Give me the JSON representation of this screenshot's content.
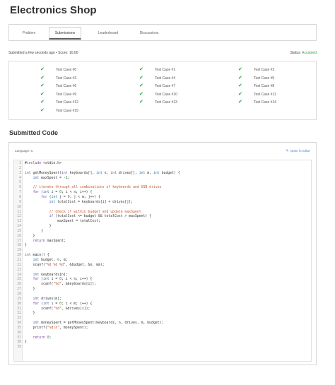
{
  "page": {
    "title": "Electronics Shop"
  },
  "tabs": [
    {
      "label": "Problem",
      "active": false
    },
    {
      "label": "Submissions",
      "active": true
    },
    {
      "label": "Leaderboard",
      "active": false
    },
    {
      "label": "Discussions",
      "active": false
    }
  ],
  "submission": {
    "info": "Submitted a few seconds ago • Score: 10.00",
    "status_label": "Status:",
    "status_value": "Accepted"
  },
  "test_cases": [
    "Test Case #0",
    "Test Case #1",
    "Test Case #2",
    "Test Case #3",
    "Test Case #4",
    "Test Case #5",
    "Test Case #6",
    "Test Case #7",
    "Test Case #8",
    "Test Case #9",
    "Test Case #10",
    "Test Case #11",
    "Test Case #12",
    "Test Case #13",
    "Test Case #14",
    "Test Case #15"
  ],
  "code_section": {
    "title": "Submitted Code",
    "language": "Language: C",
    "open_editor": "Open in editor"
  },
  "code_lines": [
    "#include <stdio.h>",
    "",
    "int getMoneySpent(int keyboards[], int n, int drives[], int m, int budget) {",
    "    int maxSpent = -1;",
    "",
    "    // iterate through all combinations of keyboards and USB drives",
    "    for (int i = 0; i < n; i++) {",
    "        for (int j = 0; j < m; j++) {",
    "            int totalCost = keyboards[i] + drives[j];",
    "",
    "            // Check if within budget and update maxSpent",
    "            if (totalCost <= budget && totalCost > maxSpent) {",
    "                maxSpent = totalCost;",
    "            }",
    "        }",
    "    }",
    "    return maxSpent;",
    "}",
    "",
    "int main() {",
    "    int budget, n, m;",
    "    scanf(\"%d %d %d\", &budget, &n, &m);",
    "",
    "    int keyboards[n];",
    "    for (int i = 0; i < n; i++) {",
    "        scanf(\"%d\", &keyboards[i]);",
    "    }",
    "",
    "    int drives[m];",
    "    for (int i = 0; i < m; i++) {",
    "        scanf(\"%d\", &drives[i]);",
    "    }",
    "",
    "    int moneySpent = getMoneySpent(keyboards, n, drives, m, budget);",
    "    printf(\"%d\\n\", moneySpent);",
    "",
    "    return 0;",
    "}",
    ""
  ],
  "colors": {
    "accent_green": "#2aa44a",
    "link_blue": "#3b7fd6"
  }
}
